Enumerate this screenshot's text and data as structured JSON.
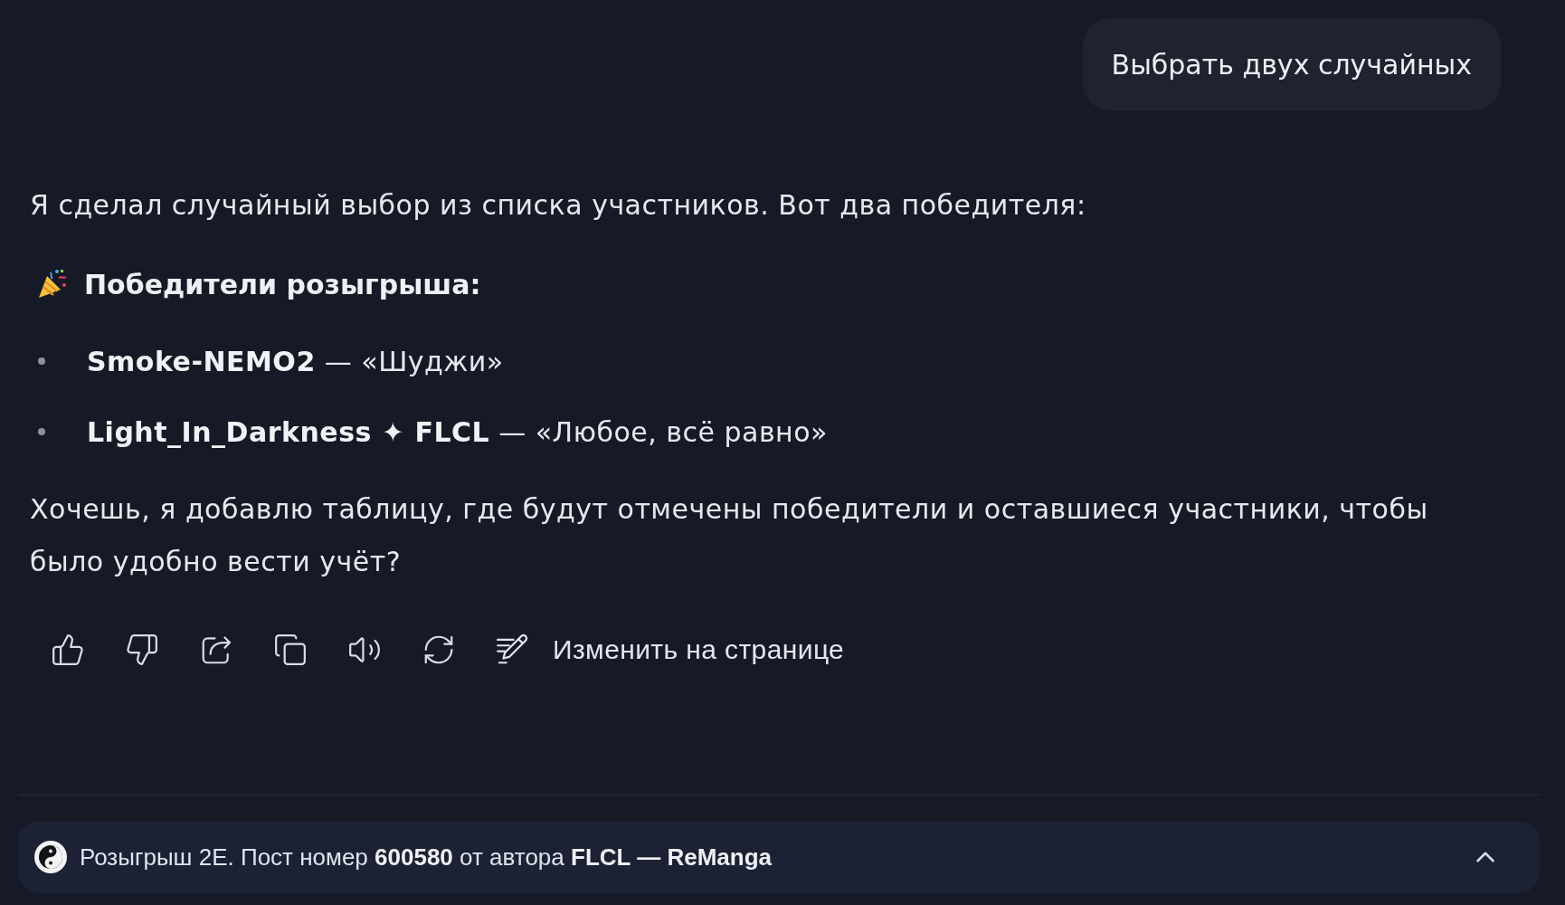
{
  "user_message": {
    "text": "Выбрать двух случайных"
  },
  "answer": {
    "intro": "Я сделал случайный выбор из списка участников. Вот два победителя:",
    "heading": "Победители розыгрыша:",
    "winners": [
      "**Smoke-NEMO2** — «Шуджи»",
      "**Light_In_Darkness ✦ FLCL** — «Любое, всё равно»"
    ],
    "follow_up": "Хочешь, я добавлю таблицу, где будут отмечены победители и оставшиеся участники, чтобы было удобно вести учёт?"
  },
  "actions": {
    "edit_label": "Изменить на странице"
  },
  "source_bar": {
    "text": "Розыгрыш 2E. Пост номер **600580** от автора **FLCL — ReManga**",
    "expanded": false
  }
}
